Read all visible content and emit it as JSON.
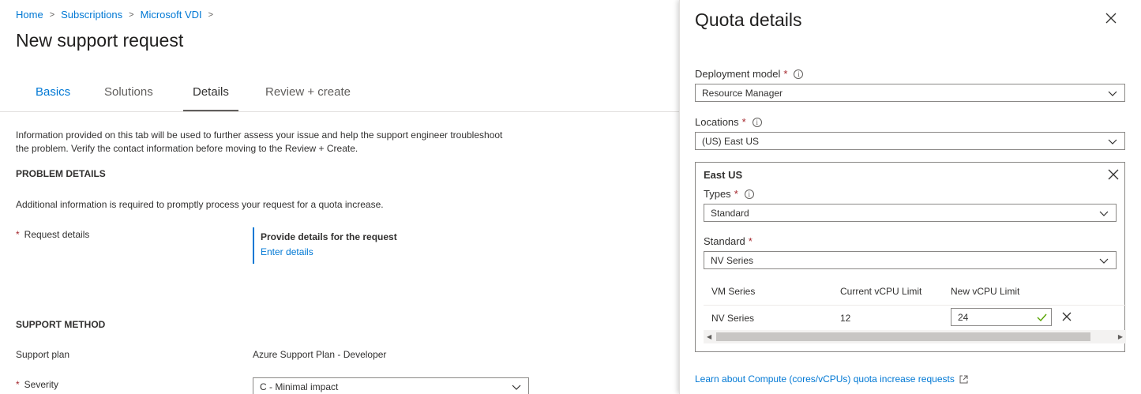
{
  "breadcrumb": [
    "Home",
    "Subscriptions",
    "Microsoft VDI"
  ],
  "page_title": "New support request",
  "tabs": [
    {
      "label": "Basics"
    },
    {
      "label": "Solutions"
    },
    {
      "label": "Details"
    },
    {
      "label": "Review + create"
    }
  ],
  "intro": "Information provided on this tab will be used to further assess your issue and help the support engineer troubleshoot the problem. Verify the contact information before moving to the Review + Create.",
  "problem_details": {
    "heading": "PROBLEM DETAILS",
    "info": "Additional information is required to promptly process your request for a quota increase.",
    "request_label": "Request details",
    "request_box_title": "Provide details for the request",
    "request_box_link": "Enter details"
  },
  "support_method": {
    "heading": "SUPPORT METHOD",
    "plan_label": "Support plan",
    "plan_value": "Azure Support Plan - Developer",
    "severity_label": "Severity",
    "severity_value": "C - Minimal impact"
  },
  "panel": {
    "title": "Quota details",
    "deployment_label": "Deployment model",
    "deployment_value": "Resource Manager",
    "locations_label": "Locations",
    "locations_value": "(US) East US",
    "location_box": {
      "title": "East US",
      "types_label": "Types",
      "types_value": "Standard",
      "standard_label": "Standard",
      "standard_value": "NV Series",
      "columns": [
        "VM Series",
        "Current vCPU Limit",
        "New vCPU Limit"
      ],
      "row": {
        "series": "NV Series",
        "current": "12",
        "new": "24"
      }
    },
    "learn_link": "Learn about Compute (cores/vCPUs) quota increase requests"
  },
  "required_mark": "*",
  "colors": {
    "accent": "#0078d4",
    "required": "#a4262c",
    "valid": "#57a300"
  }
}
